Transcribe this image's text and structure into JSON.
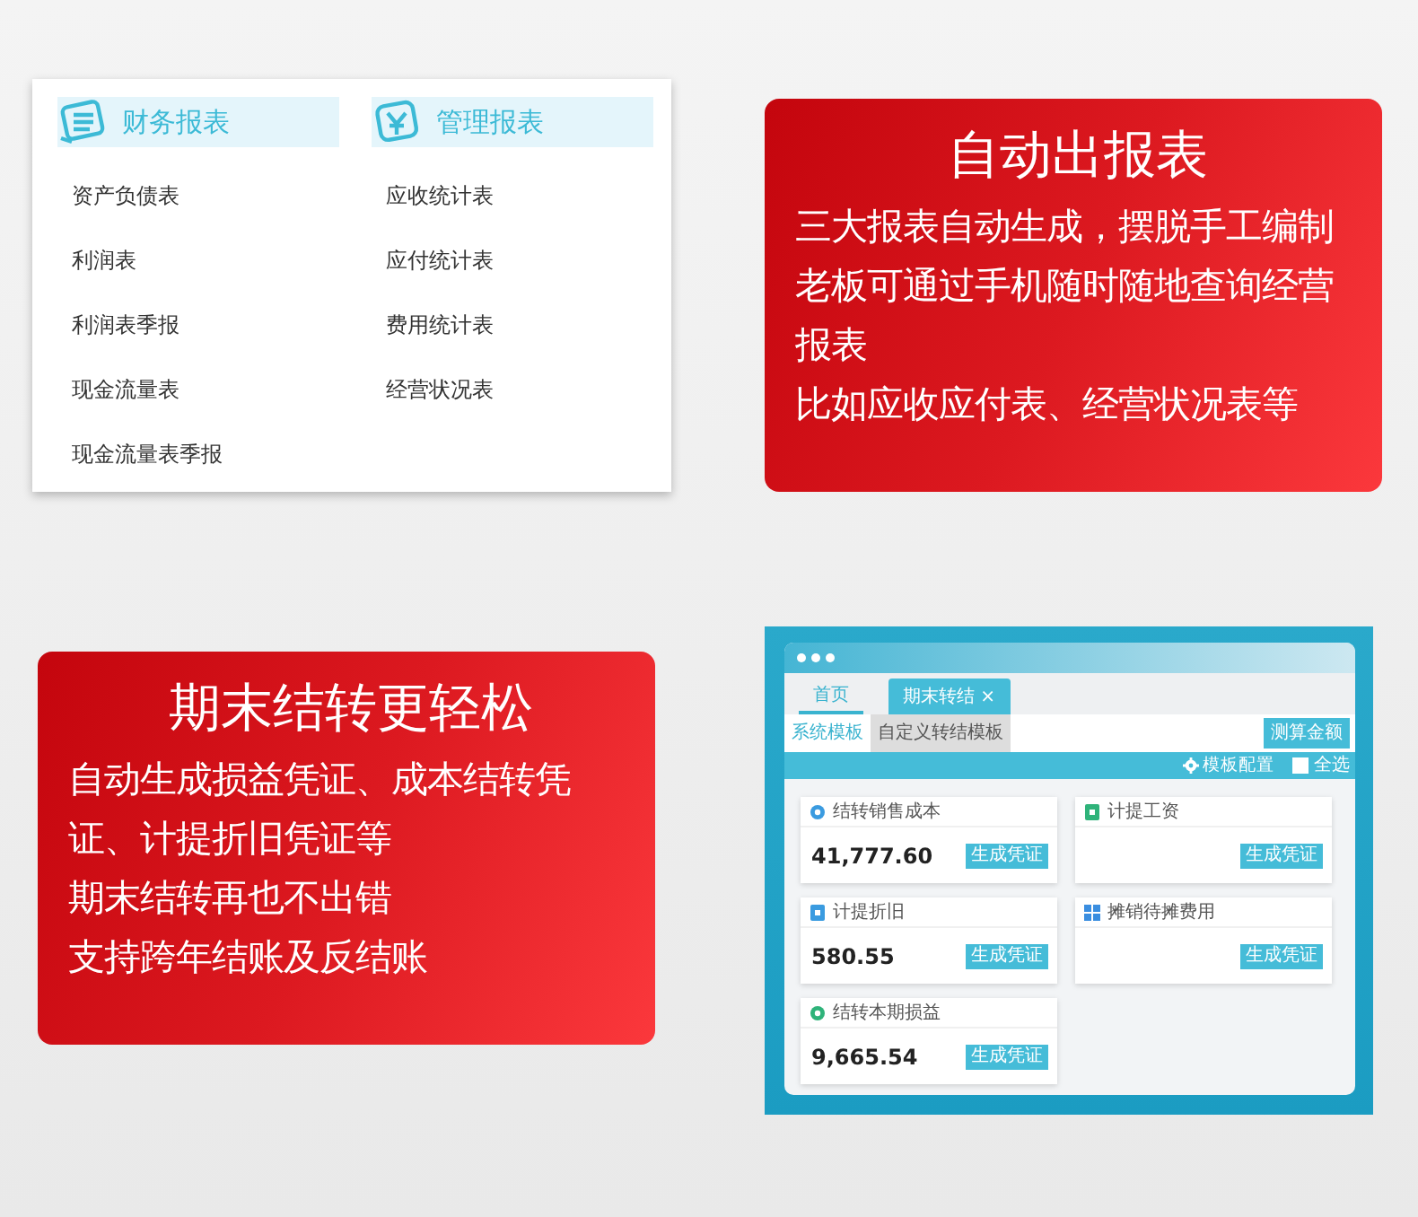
{
  "report_panel": {
    "columns": [
      {
        "kind": "list",
        "heading": "财务报表",
        "items": [
          "资产负债表",
          "利润表",
          "利润表季报",
          "现金流量表",
          "现金流量表季报"
        ]
      },
      {
        "kind": "currency",
        "heading": "管理报表",
        "items": [
          "应收统计表",
          "应付统计表",
          "费用统计表",
          "经营状况表"
        ]
      }
    ]
  },
  "feature_cards": [
    {
      "title": "自动出报表",
      "lines": [
        "三大报表自动生成，摆脱手工编制",
        "老板可通过手机随时随地查询经营报表",
        "比如应收应付表、经营状况表等"
      ]
    },
    {
      "title": "期末结转更轻松",
      "lines": [
        "自动生成损益凭证、成本结转凭证、计提折旧凭证等",
        "期末结转再也不出错",
        "支持跨年结账及反结账"
      ]
    }
  ],
  "app_window": {
    "tabs": [
      {
        "label": "首页",
        "selected": false
      },
      {
        "label": "期末转结",
        "selected": true,
        "close": "×"
      }
    ],
    "subtabs": [
      {
        "label": "系统模板",
        "selected": true
      },
      {
        "label": "自定义转结模板",
        "selected": false
      }
    ],
    "action_button": "测算金额",
    "toolbar": {
      "config": "模板配置",
      "select_all": {
        "label": "全选",
        "checked": false
      }
    },
    "cards": [
      {
        "kind": "circle",
        "color": "#3a9be0",
        "title": "结转销售成本",
        "amount": "41,777.60",
        "button": "生成凭证"
      },
      {
        "kind": "square",
        "color": "#2fb37a",
        "title": "计提工资",
        "button": "生成凭证"
      },
      {
        "kind": "square",
        "color": "#3a9be0",
        "title": "计提折旧",
        "amount": "580.55",
        "button": "生成凭证"
      },
      {
        "kind": "grid",
        "color": "#3a8ee0",
        "title": "摊销待摊费用",
        "button": "生成凭证"
      },
      {
        "kind": "circle",
        "color": "#2fb37a",
        "title": "结转本期损益",
        "amount": "9,665.54",
        "button": "生成凭证"
      }
    ]
  }
}
